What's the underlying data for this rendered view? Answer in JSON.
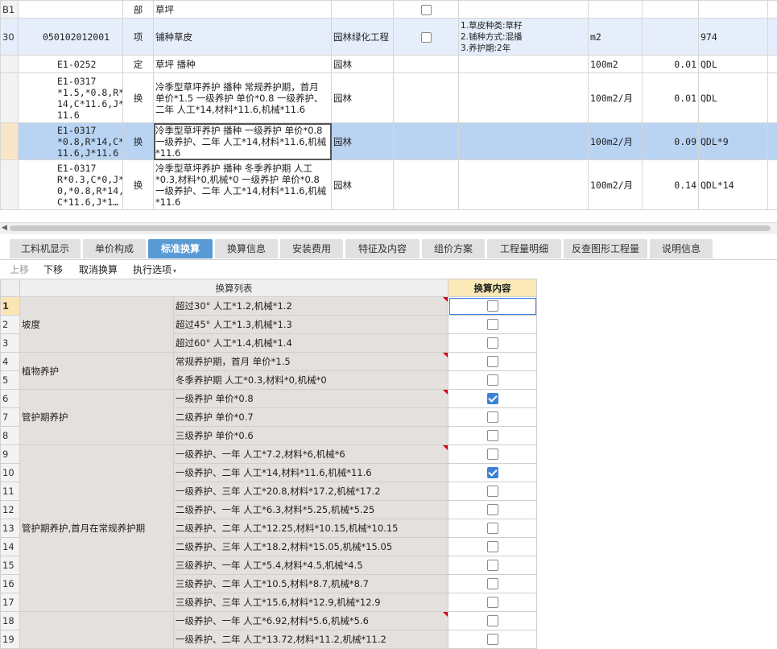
{
  "top_rows": [
    {
      "num": "B1",
      "code": "",
      "type": "部",
      "name": "草坪",
      "prof": "",
      "check": true,
      "feature": "",
      "unit": "",
      "qty": "",
      "expr": ""
    },
    {
      "num": "30",
      "code": "050102012001",
      "type": "项",
      "name": "铺种草皮",
      "prof": "园林绿化工程",
      "check": true,
      "feature": "1.草皮种类:草籽\n2.铺种方式:混播\n3.养护期:2年",
      "unit": "m2",
      "qty": "",
      "expr": "974"
    },
    {
      "num": "",
      "code": "E1-0252",
      "type": "定",
      "name": "草坪 播种",
      "prof": "园林",
      "check": false,
      "feature": "",
      "unit": "100m2",
      "qty": "0.01",
      "expr": "QDL"
    },
    {
      "num": "",
      "code": "E1-0317\n*1.5,*0.8,R*\n14,C*11.6,J*\n11.6",
      "type": "换",
      "name": "冷季型草坪养护 播种  常规养护期，首月 单价*1.5  一级养护 单价*0.8  一级养护、二年 人工*14,材料*11.6,机械*11.6",
      "prof": "园林",
      "check": false,
      "feature": "",
      "unit": "100m2/月",
      "qty": "0.01",
      "expr": "QDL"
    },
    {
      "num": "",
      "code": "E1-0317\n*0.8,R*14,C*\n11.6,J*11.6",
      "type": "换",
      "name": "冷季型草坪养护 播种  一级养护 单价*0.8  一级养护、二年 人工*14,材料*11.6,机械*11.6",
      "prof": "园林",
      "check": false,
      "feature": "",
      "unit": "100m2/月",
      "qty": "0.09",
      "expr": "QDL*9"
    },
    {
      "num": "",
      "code": "E1-0317\nR*0.3,C*0,J*\n0,*0.8,R*14,\nC*11.6,J*1…",
      "type": "换",
      "name": "冷季型草坪养护 播种  冬季养护期 人工*0.3,材料*0,机械*0  一级养护 单价*0.8  一级养护、二年 人工*14,材料*11.6,机械*11.6",
      "prof": "园林",
      "check": false,
      "feature": "",
      "unit": "100m2/月",
      "qty": "0.14",
      "expr": "QDL*14"
    }
  ],
  "tabs": [
    "工料机显示",
    "单价构成",
    "标准换算",
    "换算信息",
    "安装费用",
    "特征及内容",
    "组价方案",
    "工程量明细",
    "反查图形工程量",
    "说明信息"
  ],
  "active_tab": "标准换算",
  "toolbar": {
    "up": "上移",
    "down": "下移",
    "cancel": "取消换算",
    "exec": "执行选项"
  },
  "lower_table": {
    "header_list": "换算列表",
    "header_content": "换算内容",
    "groups": [
      {
        "label": "坡度",
        "rows": [
          {
            "n": "1",
            "text": "超过30°  人工*1.2,机械*1.2",
            "checked": false
          },
          {
            "n": "2",
            "text": "超过45°  人工*1.3,机械*1.3",
            "checked": false
          },
          {
            "n": "3",
            "text": "超过60°  人工*1.4,机械*1.4",
            "checked": false
          }
        ]
      },
      {
        "label": "植物养护",
        "rows": [
          {
            "n": "4",
            "text": "常规养护期，首月 单价*1.5",
            "checked": false
          },
          {
            "n": "5",
            "text": "冬季养护期 人工*0.3,材料*0,机械*0",
            "checked": false
          }
        ]
      },
      {
        "label": "管护期养护",
        "rows": [
          {
            "n": "6",
            "text": "一级养护 单价*0.8",
            "checked": true
          },
          {
            "n": "7",
            "text": "二级养护 单价*0.7",
            "checked": false
          },
          {
            "n": "8",
            "text": "三级养护 单价*0.6",
            "checked": false
          }
        ]
      },
      {
        "label": "管护期养护,首月在常规养护期",
        "rows": [
          {
            "n": "9",
            "text": "一级养护、一年 人工*7.2,材料*6,机械*6",
            "checked": false
          },
          {
            "n": "10",
            "text": "一级养护、二年 人工*14,材料*11.6,机械*11.6",
            "checked": true
          },
          {
            "n": "11",
            "text": "一级养护、三年 人工*20.8,材料*17.2,机械*17.2",
            "checked": false
          },
          {
            "n": "12",
            "text": "二级养护、一年 人工*6.3,材料*5.25,机械*5.25",
            "checked": false
          },
          {
            "n": "13",
            "text": "二级养护、二年 人工*12.25,材料*10.15,机械*10.15",
            "checked": false
          },
          {
            "n": "14",
            "text": "二级养护、三年 人工*18.2,材料*15.05,机械*15.05",
            "checked": false
          },
          {
            "n": "15",
            "text": "三级养护、一年 人工*5.4,材料*4.5,机械*4.5",
            "checked": false
          },
          {
            "n": "16",
            "text": "三级养护、二年 人工*10.5,材料*8.7,机械*8.7",
            "checked": false
          },
          {
            "n": "17",
            "text": "三级养护、三年 人工*15.6,材料*12.9,机械*12.9",
            "checked": false
          }
        ]
      },
      {
        "label": "",
        "rows": [
          {
            "n": "18",
            "text": "一级养护、一年 人工*6.92,材料*5.6,机械*5.6",
            "checked": false
          },
          {
            "n": "19",
            "text": "一级养护、二年 人工*13.72,材料*11.2,机械*11.2",
            "checked": false
          }
        ]
      }
    ]
  }
}
